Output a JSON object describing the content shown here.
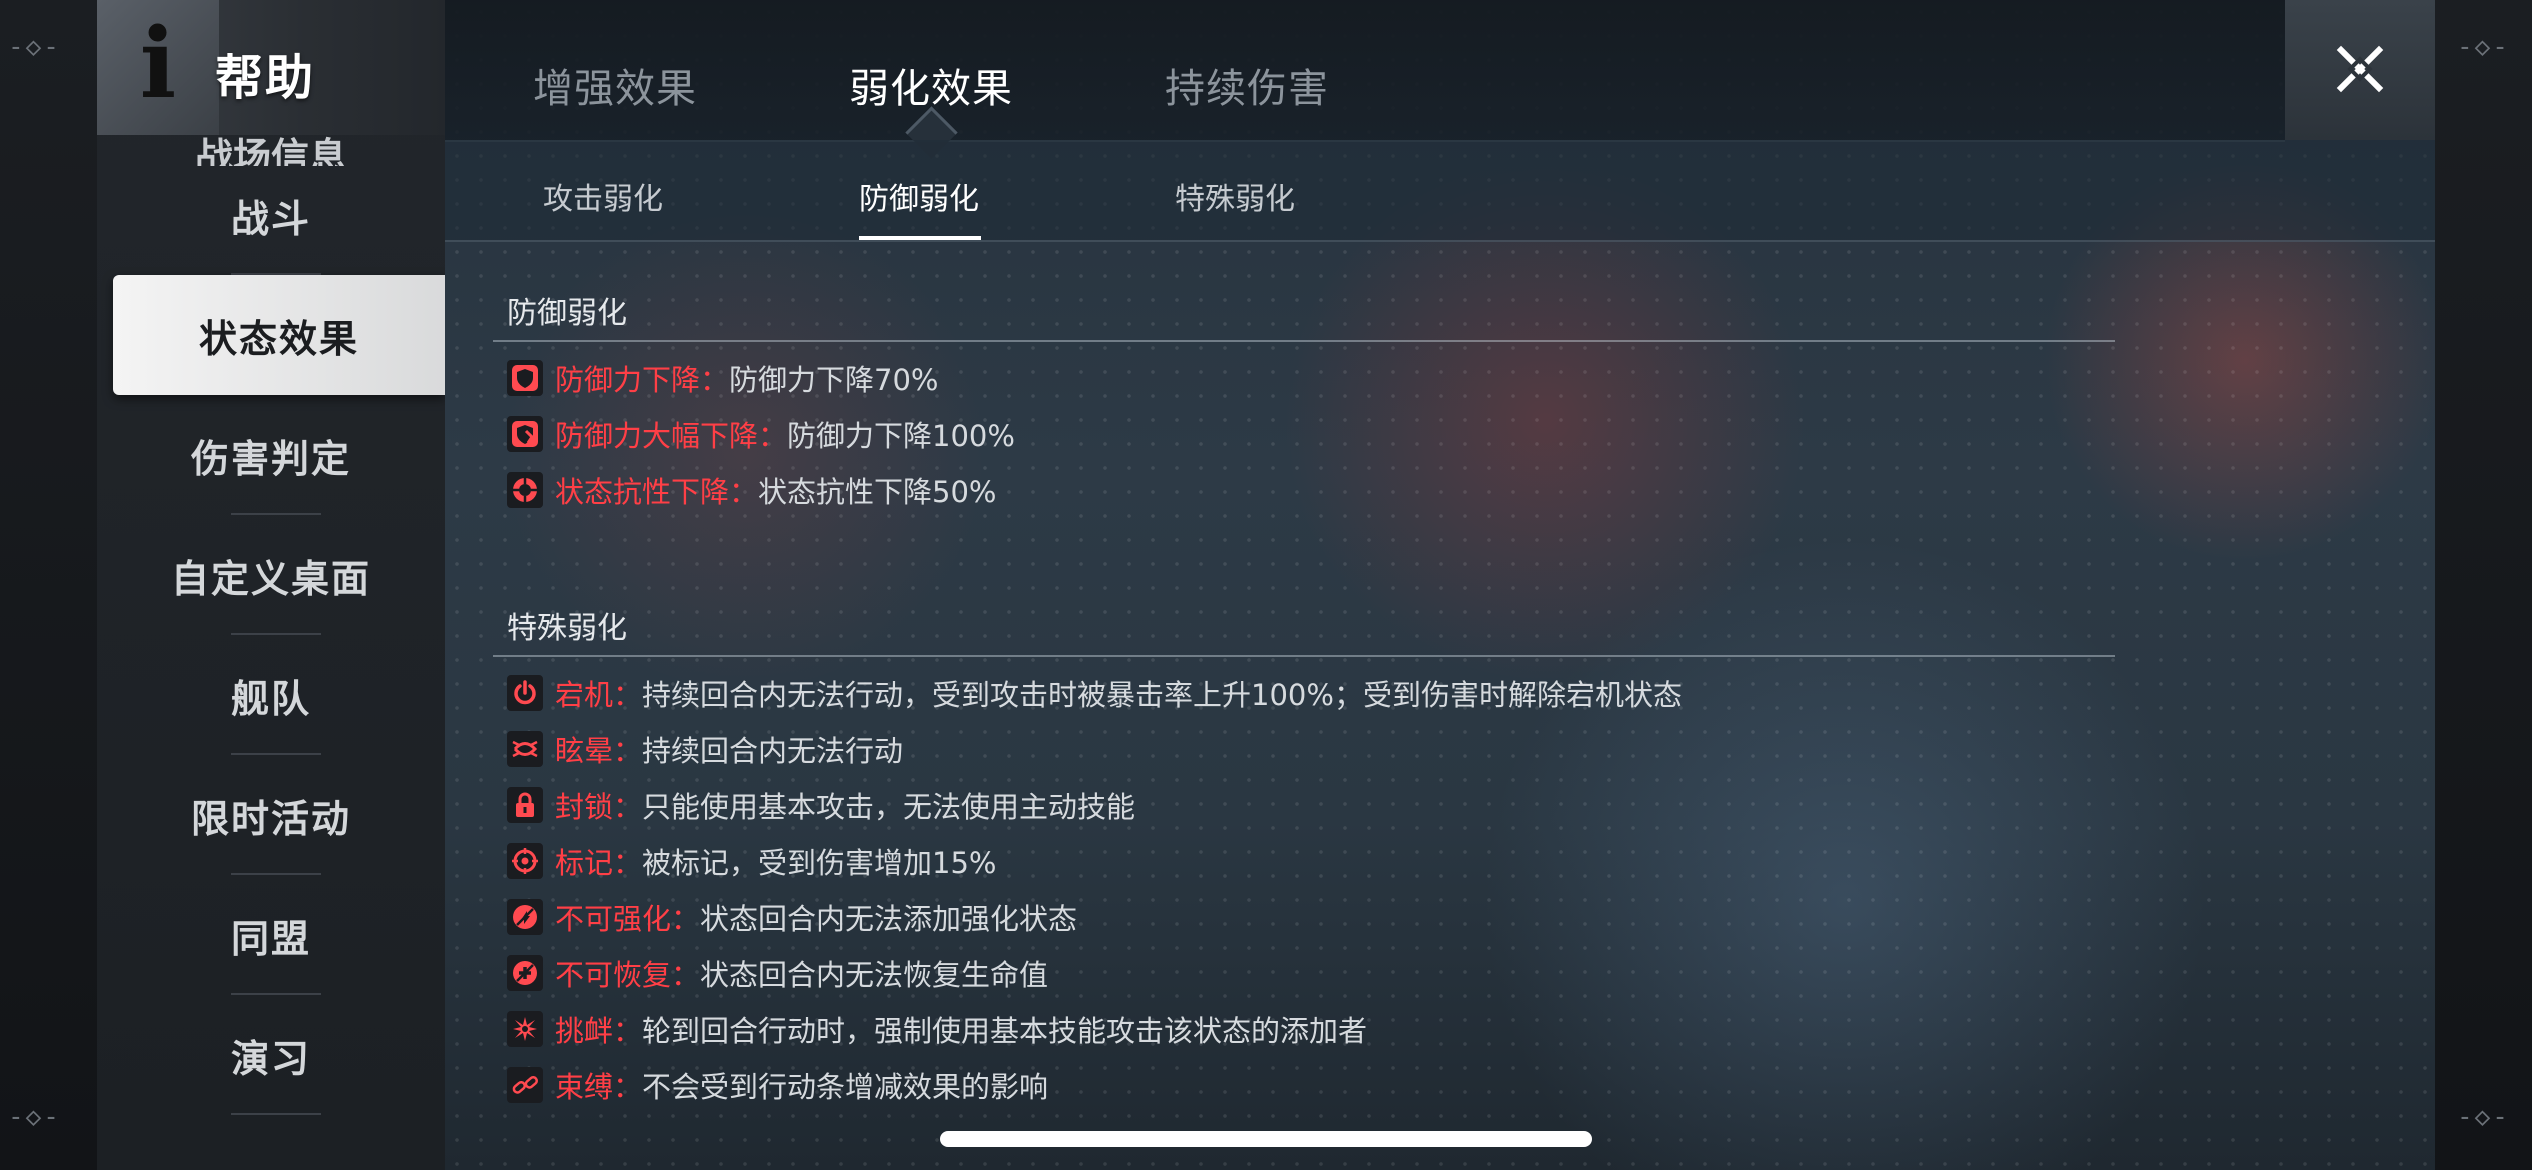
{
  "header": {
    "title": "帮助",
    "help_icon": "info-i-icon"
  },
  "sidebar": {
    "partial_item": "战场信息",
    "items": [
      {
        "label": "战斗",
        "active": false
      },
      {
        "label": "状态效果",
        "active": true
      },
      {
        "label": "伤害判定",
        "active": false
      },
      {
        "label": "自定义桌面",
        "active": false
      },
      {
        "label": "舰队",
        "active": false
      },
      {
        "label": "限时活动",
        "active": false
      },
      {
        "label": "同盟",
        "active": false
      },
      {
        "label": "演习",
        "active": false
      }
    ]
  },
  "top_tabs": [
    {
      "label": "增强效果",
      "active": false
    },
    {
      "label": "弱化效果",
      "active": true
    },
    {
      "label": "持续伤害",
      "active": false
    }
  ],
  "sub_tabs": [
    {
      "label": "攻击弱化",
      "active": false
    },
    {
      "label": "防御弱化",
      "active": true
    },
    {
      "label": "特殊弱化",
      "active": false
    }
  ],
  "sections": [
    {
      "title": "防御弱化",
      "effects": [
        {
          "icon": "shield-down-icon",
          "name": "防御力下降",
          "desc": "防御力下降70%"
        },
        {
          "icon": "shield-broken-icon",
          "name": "防御力大幅下降",
          "desc": "防御力下降100%"
        },
        {
          "icon": "resistance-down-icon",
          "name": "状态抗性下降",
          "desc": "状态抗性下降50%"
        }
      ]
    },
    {
      "title": "特殊弱化",
      "effects": [
        {
          "icon": "power-icon",
          "name": "宕机",
          "desc": "持续回合内无法行动，受到攻击时被暴击率上升100%；受到伤害时解除宕机状态"
        },
        {
          "icon": "dizzy-icon",
          "name": "眩晕",
          "desc": "持续回合内无法行动"
        },
        {
          "icon": "lock-icon",
          "name": "封锁",
          "desc": "只能使用基本攻击，无法使用主动技能"
        },
        {
          "icon": "target-icon",
          "name": "标记",
          "desc": "被标记，受到伤害增加15%"
        },
        {
          "icon": "no-buff-icon",
          "name": "不可强化",
          "desc": "状态回合内无法添加强化状态"
        },
        {
          "icon": "no-heal-icon",
          "name": "不可恢复",
          "desc": "状态回合内无法恢复生命值"
        },
        {
          "icon": "taunt-icon",
          "name": "挑衅",
          "desc": "轮到回合行动时，强制使用基本技能攻击该状态的添加者"
        },
        {
          "icon": "chain-icon",
          "name": "束缚",
          "desc": "不会受到行动条增减效果的影响"
        }
      ]
    }
  ],
  "colors": {
    "effect_name": "#ff3f46",
    "accent_white": "#ffffff"
  }
}
